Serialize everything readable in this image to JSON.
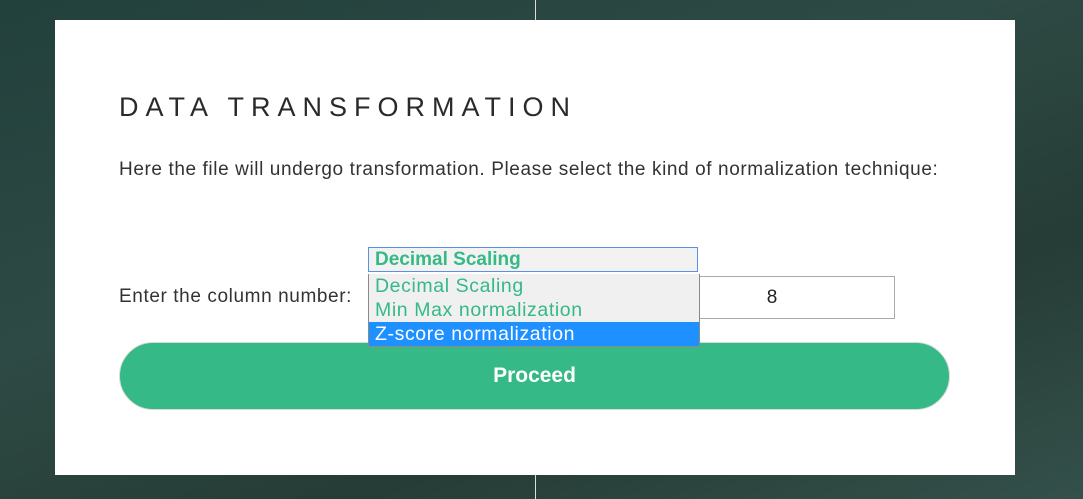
{
  "page": {
    "title": "DATA TRANSFORMATION",
    "description": "Here the file will undergo transformation. Please select the kind of normalization technique:"
  },
  "normalization": {
    "selected": "Decimal Scaling",
    "options": [
      "Decimal Scaling",
      "Min Max normalization",
      "Z-score normalization"
    ],
    "highlighted_option": "Z-score normalization"
  },
  "column": {
    "label": "Enter the column number:",
    "value": "8"
  },
  "actions": {
    "proceed_label": "Proceed"
  },
  "colors": {
    "accent": "#35b987",
    "highlight": "#1e90ff",
    "focus_border": "#5c8fe6"
  }
}
